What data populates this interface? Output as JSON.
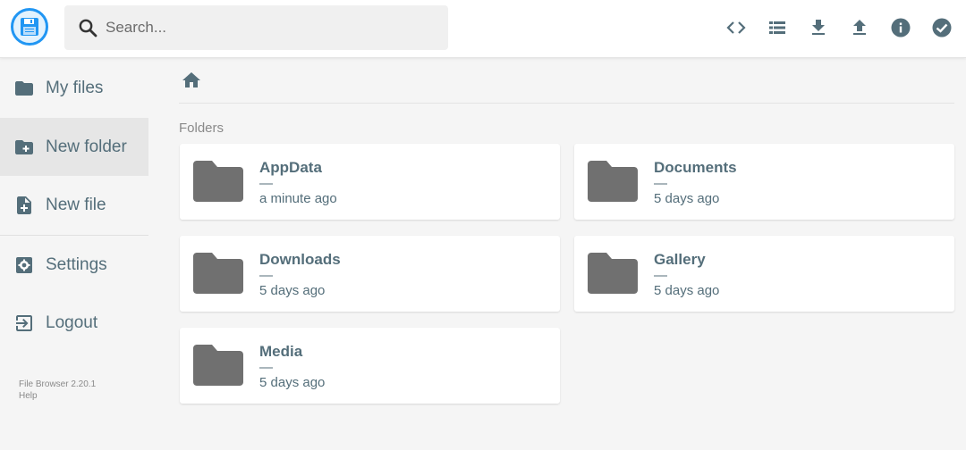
{
  "header": {
    "search_placeholder": "Search...",
    "actions": [
      {
        "icon": "code-icon"
      },
      {
        "icon": "list-view-icon"
      },
      {
        "icon": "download-icon"
      },
      {
        "icon": "upload-icon"
      },
      {
        "icon": "info-icon"
      },
      {
        "icon": "check-circle-icon"
      }
    ]
  },
  "sidebar": {
    "items": [
      {
        "label": "My files",
        "icon": "folder-icon"
      },
      {
        "label": "New folder",
        "icon": "create-new-folder-icon"
      },
      {
        "label": "New file",
        "icon": "note-add-icon"
      },
      {
        "label": "Settings",
        "icon": "settings-icon"
      },
      {
        "label": "Logout",
        "icon": "logout-icon"
      }
    ],
    "credits": {
      "version": "File Browser 2.20.1",
      "help": "Help"
    }
  },
  "main": {
    "section_title": "Folders",
    "folders": [
      {
        "name": "AppData",
        "size": "—",
        "modified": "a minute ago"
      },
      {
        "name": "Documents",
        "size": "—",
        "modified": "5 days ago"
      },
      {
        "name": "Downloads",
        "size": "—",
        "modified": "5 days ago"
      },
      {
        "name": "Gallery",
        "size": "—",
        "modified": "5 days ago"
      },
      {
        "name": "Media",
        "size": "—",
        "modified": "5 days ago"
      }
    ]
  },
  "colors": {
    "accent": "#2196f3",
    "icon": "#546e7a",
    "folder": "#707070",
    "active_bg": "#e6e6e6"
  }
}
